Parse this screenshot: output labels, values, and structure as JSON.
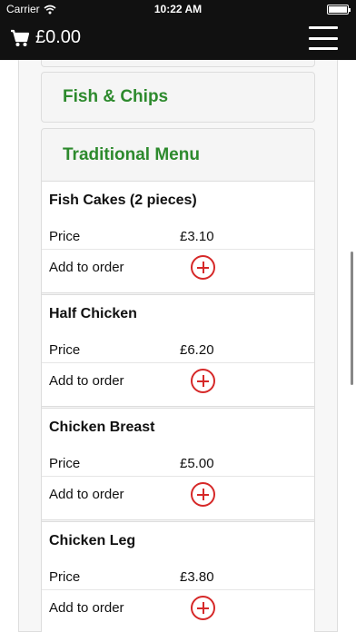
{
  "status": {
    "carrier": "Carrier",
    "time": "10:22 AM",
    "battery_level": 0.95
  },
  "nav": {
    "cart_total": "£0.00",
    "cart_icon": "cart-icon",
    "menu_icon": "hamburger-icon"
  },
  "categories": [
    {
      "title": "Fish & Chips"
    },
    {
      "title": "Traditional Menu"
    }
  ],
  "labels": {
    "price": "Price",
    "add": "Add to order"
  },
  "items": [
    {
      "name": "Fish Cakes (2 pieces)",
      "price": "£3.10"
    },
    {
      "name": "Half Chicken",
      "price": "£6.20"
    },
    {
      "name": "Chicken Breast",
      "price": "£5.00"
    },
    {
      "name": "Chicken Leg",
      "price": "£3.80"
    }
  ],
  "colors": {
    "accent_green": "#2d8a2d",
    "add_red": "#d62828",
    "bar": "#111111"
  }
}
